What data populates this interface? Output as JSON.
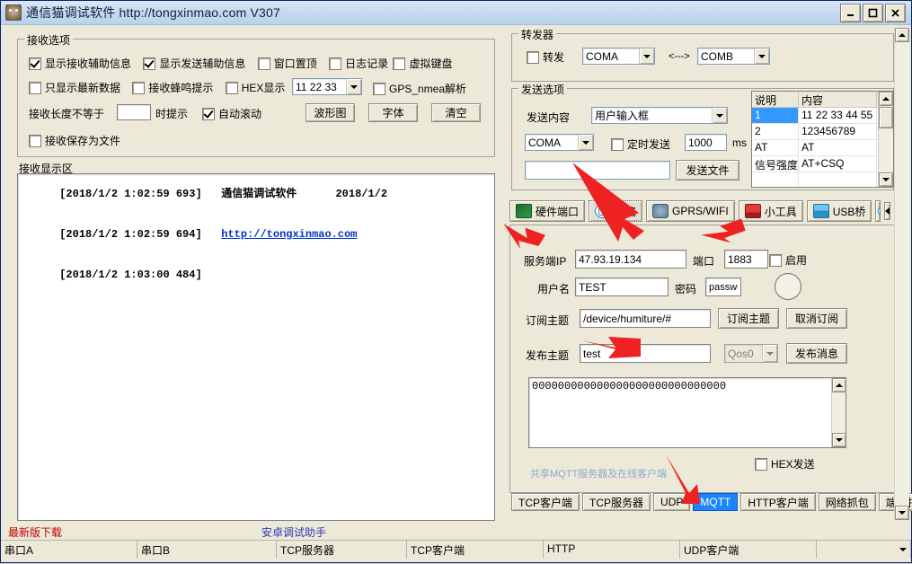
{
  "window": {
    "title": "通信猫调试软件  http://tongxinmao.com  V307",
    "minimize": "_",
    "maximize": "□",
    "close": "✕"
  },
  "receive_options": {
    "legend": "接收选项",
    "checkboxes": [
      {
        "label": "显示接收辅助信息",
        "checked": true
      },
      {
        "label": "显示发送辅助信息",
        "checked": true
      },
      {
        "label": "窗口置顶",
        "checked": false
      },
      {
        "label": "日志记录",
        "checked": false
      },
      {
        "label": "虚拟键盘",
        "checked": false
      },
      {
        "label": "只显示最新数据",
        "checked": false
      },
      {
        "label": "接收蜂鸣提示",
        "checked": false
      },
      {
        "label": "HEX显示",
        "checked": false
      },
      {
        "label": "GPS_nmea解析",
        "checked": false
      },
      {
        "label": "自动滚动",
        "checked": true
      },
      {
        "label": "接收保存为文件",
        "checked": false
      }
    ],
    "hex_combo_value": "11 22 33",
    "length_label_prefix": "接收长度不等于",
    "length_value": "",
    "length_label_suffix": "时提示",
    "buttons": [
      "波形图",
      "字体",
      "清空"
    ]
  },
  "receive_display": {
    "label": "接收显示区",
    "lines": [
      {
        "time": "[2018/1/2 1:02:59 693]",
        "text": "通信猫调试软件      2018/1/2",
        "is_link": false
      },
      {
        "time": "[2018/1/2 1:02:59 694]",
        "text": "http://tongxinmao.com",
        "is_link": true
      },
      {
        "time": "[2018/1/2 1:03:00 484]",
        "text": "",
        "is_link": false
      }
    ]
  },
  "forwarder": {
    "legend": "转发器",
    "enable_label": "转发",
    "enable_checked": false,
    "port_a": "COMA",
    "separator": "<--->",
    "port_b": "COMB"
  },
  "send_options": {
    "legend": "发送选项",
    "content_label": "发送内容",
    "content_value": "用户输入框",
    "port_value": "COMA",
    "timed_label": "定时发送",
    "timed_checked": false,
    "interval_value": "1000",
    "interval_unit": "ms",
    "input_value": "",
    "send_file_button": "发送文件"
  },
  "sequence_table": {
    "headers": [
      "说明",
      "内容"
    ],
    "rows": [
      {
        "desc": "1",
        "content": "11 22 33 44 55",
        "selected": true
      },
      {
        "desc": "2",
        "content": "123456789",
        "selected": false
      },
      {
        "desc": "AT",
        "content": "AT",
        "selected": false
      },
      {
        "desc": "信号强度",
        "content": "AT+CSQ",
        "selected": false
      }
    ]
  },
  "tabs": [
    {
      "label": "硬件端口",
      "icon": "hardware-port-icon",
      "active": false
    },
    {
      "label": "网络",
      "icon": "network-icon",
      "active": true
    },
    {
      "label": "GPRS/WIFI",
      "icon": "gprs-wifi-icon",
      "active": false
    },
    {
      "label": "小工具",
      "icon": "toolbox-icon",
      "active": false
    },
    {
      "label": "USB桥",
      "icon": "usb-icon",
      "active": false
    }
  ],
  "mqtt": {
    "server_ip_label": "服务端IP",
    "server_ip_value": "47.93.19.134",
    "port_label": "端口",
    "port_value": "1883",
    "enable_label": "启用",
    "enable_checked": false,
    "username_label": "用户名",
    "username_value": "TEST",
    "password_label": "密码",
    "password_value": "passwo",
    "subscribe_label": "订阅主题",
    "subscribe_value": "/device/humiture/#",
    "subscribe_button": "订阅主题",
    "unsubscribe_button": "取消订阅",
    "publish_label": "发布主题",
    "publish_value": "test",
    "qos_value": "Qos0",
    "publish_button": "发布消息",
    "message_value": "000000000000000000000000000000",
    "hex_send_label": "HEX发送",
    "hex_send_checked": false,
    "share_link": "共享MQTT服务器及在线客户端"
  },
  "sub_tabs": [
    {
      "label": "TCP客户端",
      "active": false
    },
    {
      "label": "TCP服务器",
      "active": false
    },
    {
      "label": "UDP",
      "active": false
    },
    {
      "label": "MQTT",
      "active": true
    },
    {
      "label": "HTTP客户端",
      "active": false
    },
    {
      "label": "网络抓包",
      "active": false
    },
    {
      "label": "端口扫描",
      "active": false
    }
  ],
  "bottom_links": {
    "download": "最新版下载",
    "android": "安卓调试助手"
  },
  "status_bar": [
    "串口A",
    "串口B",
    "TCP服务器",
    "TCP客户端",
    "HTTP",
    "UDP客户端"
  ],
  "colors": {
    "accent": "#1a85ff",
    "link": "#0033cc",
    "annotation": "#ee2222",
    "selection": "#3399ff"
  }
}
